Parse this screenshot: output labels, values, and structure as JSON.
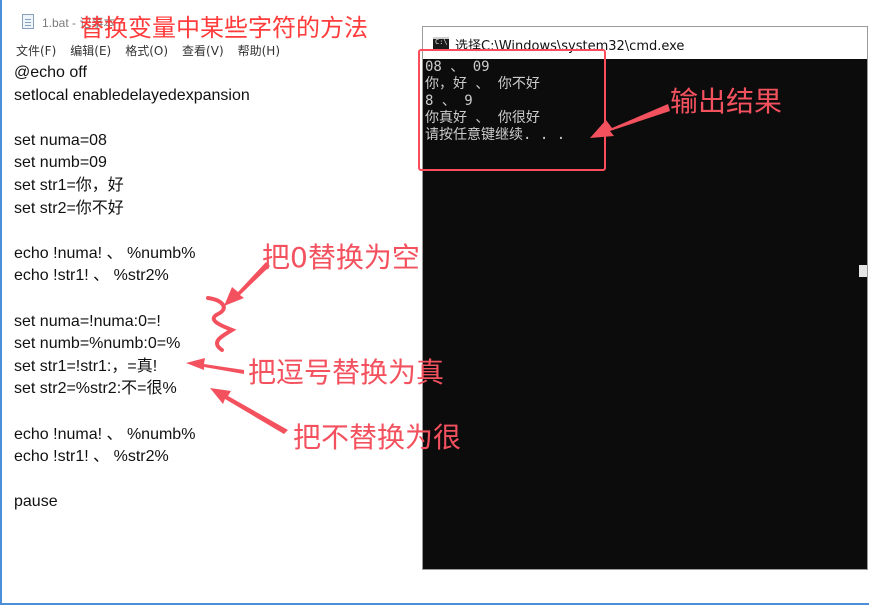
{
  "heading": "替换变量中某些字符的方法",
  "notepad": {
    "title": "1.bat - 记事本",
    "menu": [
      "文件(F)",
      "编辑(E)",
      "格式(O)",
      "查看(V)",
      "帮助(H)"
    ],
    "code": [
      "@echo off",
      "setlocal enabledelayedexpansion",
      "",
      "set numa=08",
      "set numb=09",
      "set str1=你，好",
      "set str2=你不好",
      "",
      "echo !numa! 、 %numb%",
      "echo !str1! 、 %str2%",
      "",
      "set numa=!numa:0=!",
      "set numb=%numb:0=%",
      "set str1=!str1:，=真!",
      "set str2=%str2:不=很%",
      "",
      "echo !numa! 、 %numb%",
      "echo !str1! 、 %str2%",
      "",
      "pause"
    ]
  },
  "cmd": {
    "icon_label": "C:\\",
    "title": "选择C:\\Windows\\system32\\cmd.exe",
    "output": [
      "08 、 09",
      "你，好 、 你不好",
      "8 、 9",
      "你真好 、 你很好",
      "请按任意键继续. . ."
    ]
  },
  "annotations": {
    "output_result": "输出结果",
    "replace_zero": "把0替换为空",
    "replace_comma": "把逗号替换为真",
    "replace_not": "把不替换为很"
  },
  "colors": {
    "annotation": "#f4515f",
    "heading": "#ff3b3b",
    "console_bg": "#0c0c0c",
    "console_text": "#cccccc",
    "frame": "#4a8fd8"
  }
}
